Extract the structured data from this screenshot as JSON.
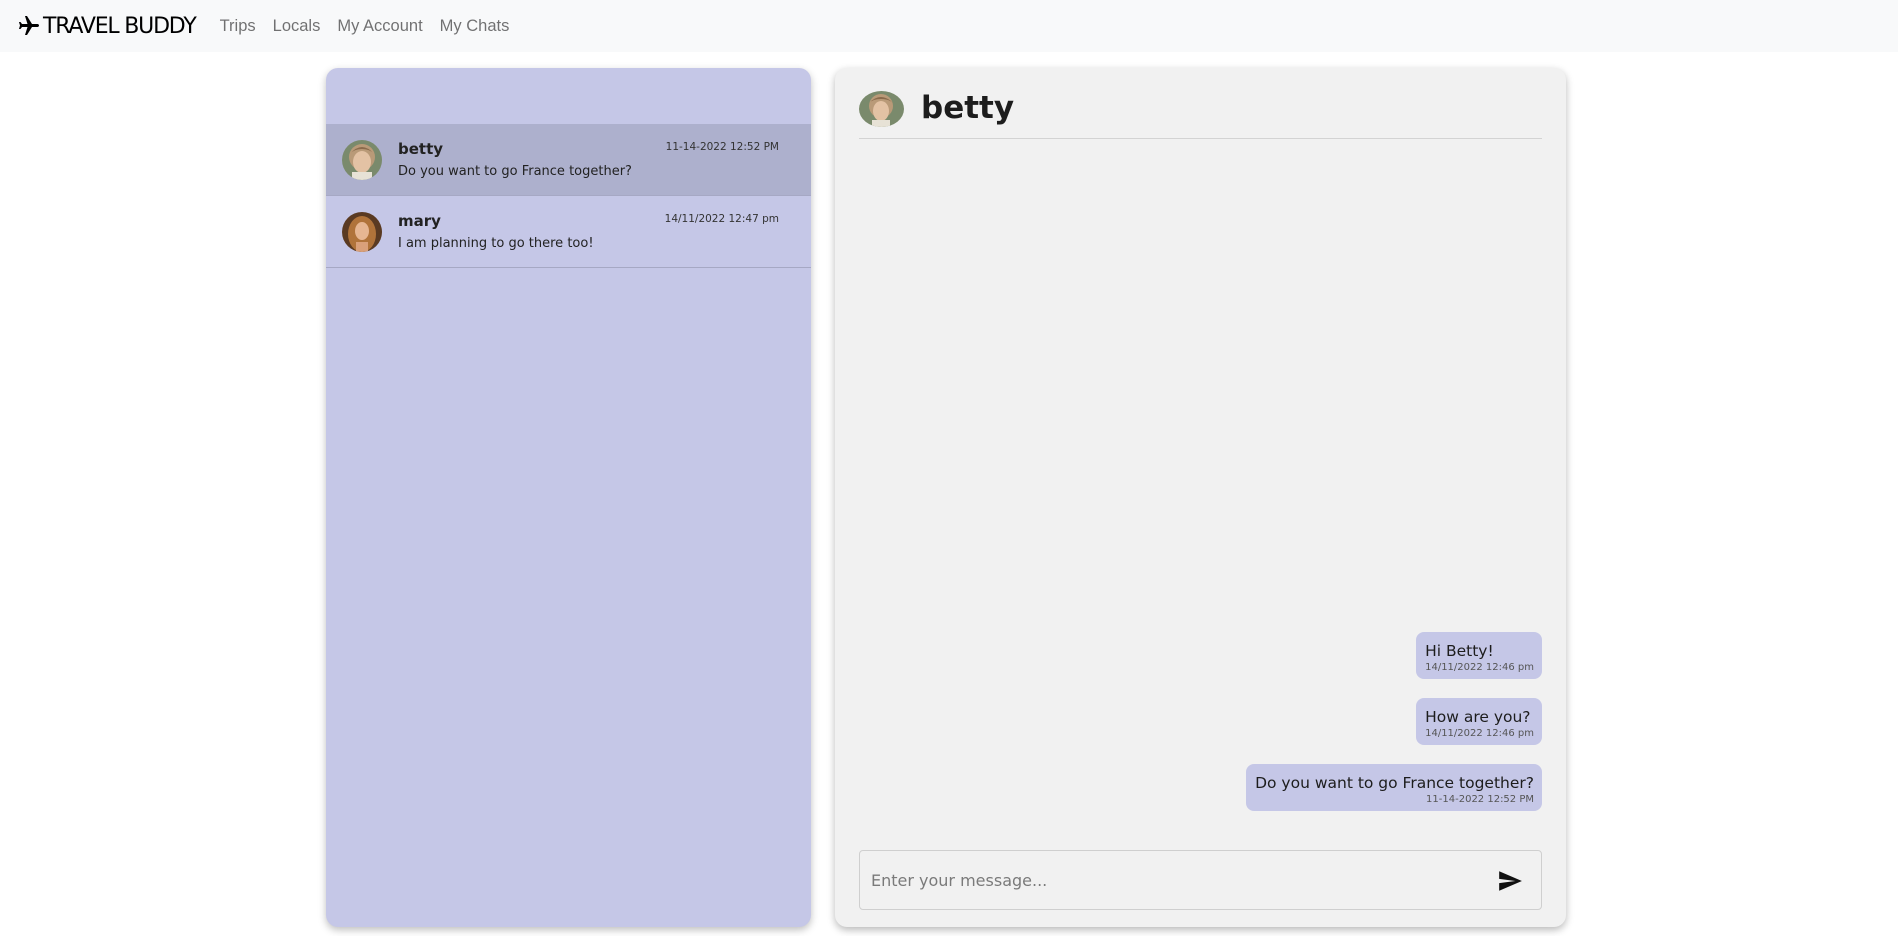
{
  "navbar": {
    "brand": "TRAVEL BUDDY",
    "brand_icon": "airplane-icon",
    "links": [
      "Trips",
      "Locals",
      "My Account",
      "My Chats"
    ]
  },
  "chat_list": [
    {
      "name": "betty",
      "preview": "Do you want to go France together?",
      "time": "11-14-2022 12:52 PM",
      "active": true
    },
    {
      "name": "mary",
      "preview": "I am planning to go there too!",
      "time": "14/11/2022 12:47 pm",
      "active": false
    }
  ],
  "conversation": {
    "contact_name": "betty",
    "messages": [
      {
        "text": "Hi Betty!",
        "time": "14/11/2022 12:46 pm"
      },
      {
        "text": "How are you?",
        "time": "14/11/2022 12:46 pm"
      },
      {
        "text": "Do you want to go France together?",
        "time": "11-14-2022 12:52 PM"
      }
    ],
    "composer": {
      "placeholder": "Enter your message...",
      "value": "",
      "send_icon": "send-icon"
    }
  },
  "colors": {
    "panel_lavender": "#c5c7e7",
    "active_row": "#adb0cd",
    "chat_bg": "#f1f1f1",
    "navbar_bg": "#f8f9fa"
  }
}
